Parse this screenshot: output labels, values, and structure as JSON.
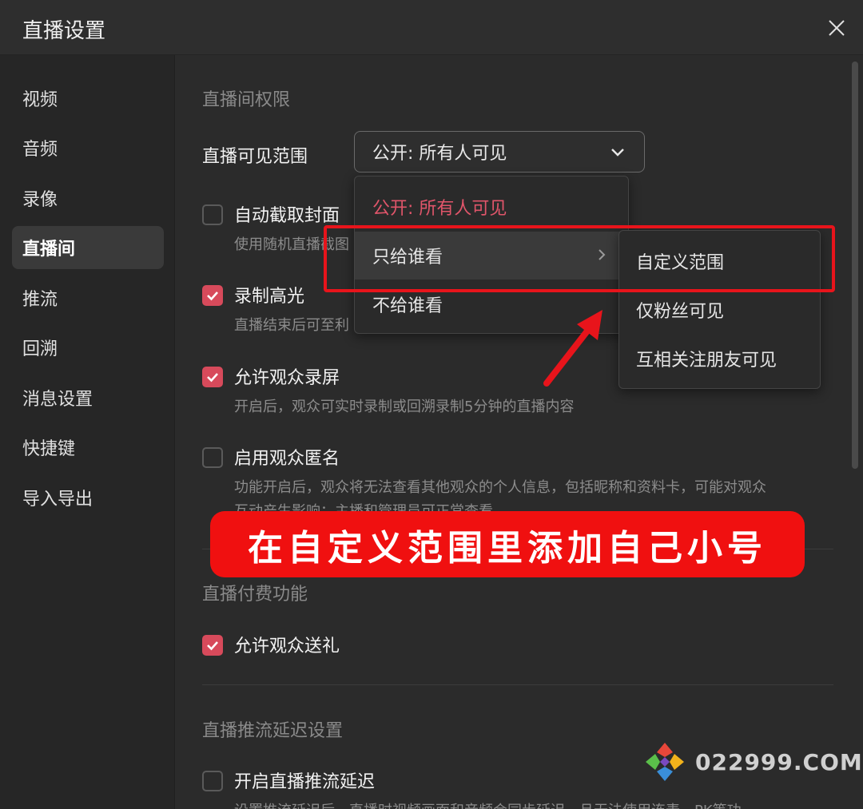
{
  "window": {
    "title": "直播设置"
  },
  "sidebar": {
    "items": [
      {
        "label": "视频"
      },
      {
        "label": "音频"
      },
      {
        "label": "录像"
      },
      {
        "label": "直播间",
        "active": true
      },
      {
        "label": "推流"
      },
      {
        "label": "回溯"
      },
      {
        "label": "消息设置"
      },
      {
        "label": "快捷键"
      },
      {
        "label": "导入导出"
      }
    ]
  },
  "main": {
    "sections": {
      "permissions": "直播间权限",
      "paid": "直播付费功能",
      "delay": "直播推流延迟设置"
    },
    "visibility": {
      "label": "直播可见范围",
      "value": "公开: 所有人可见"
    },
    "options": {
      "auto_cover": {
        "label": "自动截取封面",
        "desc": "使用随机直播截图",
        "checked": false
      },
      "record_highlight": {
        "label": "录制高光",
        "desc": "直播结束后可至利",
        "checked": true
      },
      "allow_record": {
        "label": "允许观众录屏",
        "desc": "开启后，观众可实时录制或回溯录制5分钟的直播内容",
        "checked": true
      },
      "anonymous": {
        "label": "启用观众匿名",
        "desc": "功能开启后，观众将无法查看其他观众的个人信息，包括昵称和资料卡，可能对观众",
        "desc2": "互动产生影响；主播和管理员可正常查看",
        "checked": false
      },
      "allow_gift": {
        "label": "允许观众送礼",
        "checked": true
      },
      "stream_delay": {
        "label": "开启直播推流延迟",
        "desc": "设置推流延迟后，直播时视频画面和音频会同步延迟，且无法使用连麦、PK等功",
        "checked": false
      }
    },
    "dropdown": {
      "items": [
        "公开: 所有人可见",
        "只给谁看",
        "不给谁看"
      ],
      "selected_index": 0,
      "hover_index": 1
    },
    "submenu": {
      "items": [
        "自定义范围",
        "仅粉丝可见",
        "互相关注朋友可见"
      ]
    }
  },
  "annotation": {
    "banner_text": "在自定义范围里添加自己小号",
    "highlight_color": "#e8141b"
  },
  "watermark": {
    "text": "022999.COM"
  },
  "colors": {
    "accent": "#d74a5b",
    "selected_text": "#e0556a",
    "background": "#2b2b2b"
  }
}
